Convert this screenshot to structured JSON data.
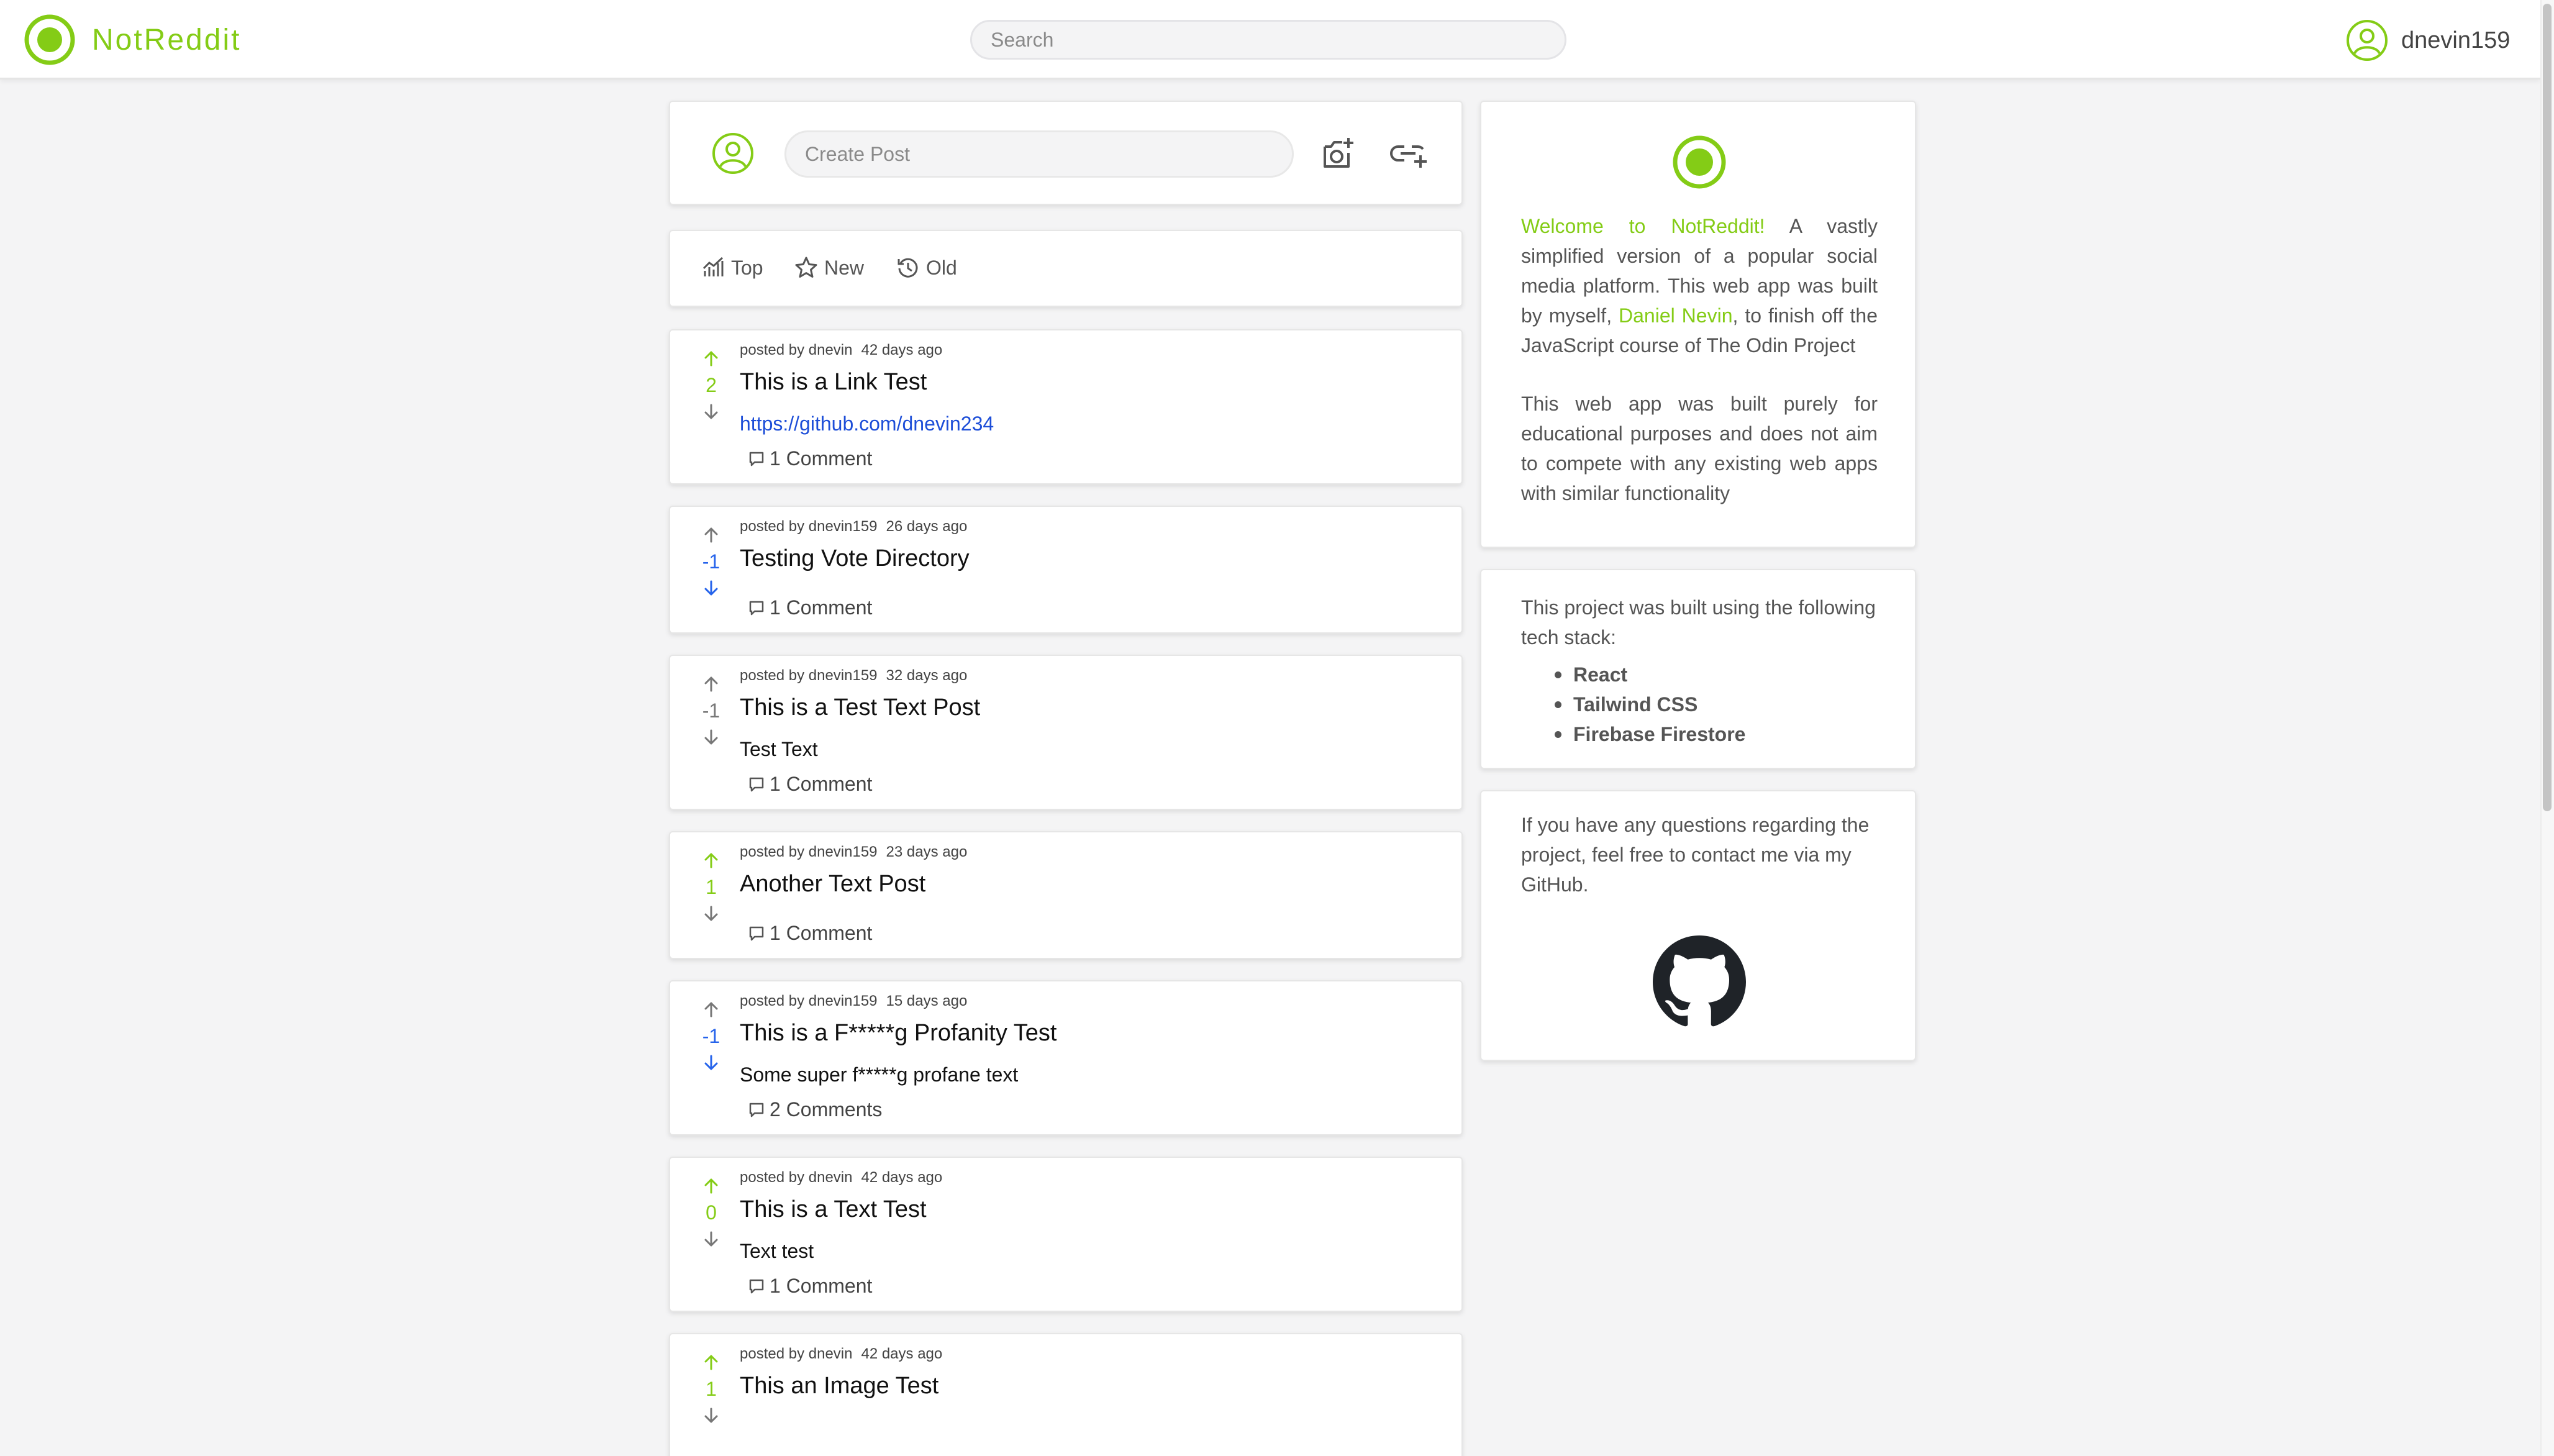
{
  "brand": {
    "name": "NotReddit",
    "accent_color": "#84cc16"
  },
  "search": {
    "placeholder": "Search"
  },
  "user": {
    "name": "dnevin159"
  },
  "create_post": {
    "placeholder": "Create Post"
  },
  "sort": {
    "top": "Top",
    "new": "New",
    "old": "Old"
  },
  "posts": [
    {
      "author": "posted by dnevin",
      "time": "42 days ago",
      "title": "This is a Link Test",
      "link": "https://github.com/dnevin234",
      "votes": "2",
      "vote_state": "up",
      "comments": "1 Comment"
    },
    {
      "author": "posted by dnevin159",
      "time": "26 days ago",
      "title": "Testing Vote Directory",
      "votes": "-1",
      "vote_state": "down",
      "comments": "1 Comment"
    },
    {
      "author": "posted by dnevin159",
      "time": "32 days ago",
      "title": "This is a Test Text Post",
      "body": "Test Text",
      "votes": "-1",
      "vote_state": "none",
      "comments": "1 Comment"
    },
    {
      "author": "posted by dnevin159",
      "time": "23 days ago",
      "title": "Another Text Post",
      "votes": "1",
      "vote_state": "up",
      "comments": "1 Comment"
    },
    {
      "author": "posted by dnevin159",
      "time": "15 days ago",
      "title": "This is a F*****g Profanity Test",
      "body": "Some super f*****g profane text",
      "votes": "-1",
      "vote_state": "down",
      "comments": "2 Comments"
    },
    {
      "author": "posted by dnevin",
      "time": "42 days ago",
      "title": "This is a Text Test",
      "body": "Text test",
      "votes": "0",
      "vote_state": "up",
      "comments": "1 Comment"
    },
    {
      "author": "posted by dnevin",
      "time": "42 days ago",
      "title": "This an Image Test",
      "votes": "1",
      "vote_state": "up"
    }
  ],
  "sidebar": {
    "welcome": {
      "highlight": "Welcome to NotReddit!",
      "text_1": " A vastly simplified version of a popular social media platform. This web app was built by myself, ",
      "author_name": "Daniel Nevin",
      "text_2": ", to finish off the JavaScript course of The Odin Project",
      "paragraph_2": "This web app was built purely for educational purposes and does not aim to compete with any existing web apps with similar functionality"
    },
    "tech": {
      "intro": "This project was built using the following tech stack:",
      "items": [
        "React",
        "Tailwind CSS",
        "Firebase Firestore"
      ]
    },
    "contact": {
      "text": "If you have any questions regarding the project, feel free to contact me via my GitHub."
    }
  }
}
